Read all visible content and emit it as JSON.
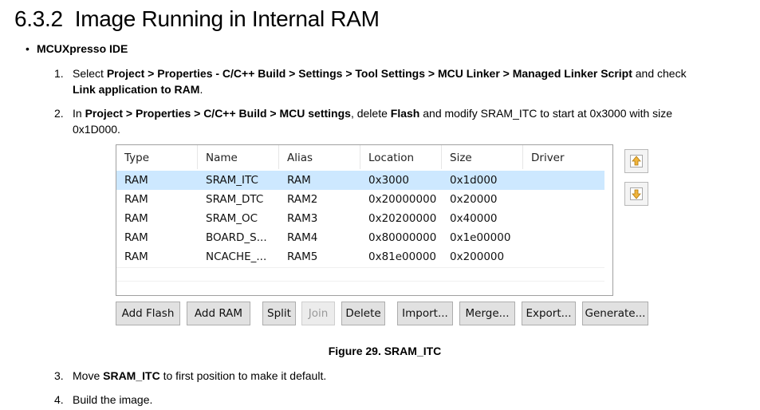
{
  "heading": {
    "number": "6.3.2",
    "title": "Image Running in Internal RAM"
  },
  "bullet": {
    "label": "MCUXpresso IDE"
  },
  "steps": [
    {
      "num": "1.",
      "t1": "Select ",
      "b1": "Project > Properties - C/C++ Build > Settings > Tool Settings > MCU Linker > Managed Linker Script",
      "t2": " and check ",
      "b2": "Link application to RAM",
      "t3": "."
    },
    {
      "num": "2.",
      "t1": "In ",
      "b1": "Project > Properties > C/C++ Build > MCU settings",
      "t2": ", delete ",
      "b2": "Flash",
      "t3": " and modify SRAM_ITC to start at 0x3000 with size 0x1D000."
    },
    {
      "num": "3.",
      "t1": "Move ",
      "b1": "SRAM_ITC",
      "t2": " to first position to make it default."
    },
    {
      "num": "4.",
      "t1": "Build the image."
    }
  ],
  "table": {
    "headers": [
      "Type",
      "Name",
      "Alias",
      "Location",
      "Size",
      "Driver"
    ],
    "rows": [
      [
        "RAM",
        "SRAM_ITC",
        "RAM",
        "0x3000",
        "0x1d000",
        ""
      ],
      [
        "RAM",
        "SRAM_DTC",
        "RAM2",
        "0x20000000",
        "0x20000",
        ""
      ],
      [
        "RAM",
        "SRAM_OC",
        "RAM3",
        "0x20200000",
        "0x40000",
        ""
      ],
      [
        "RAM",
        "BOARD_S...",
        "RAM4",
        "0x80000000",
        "0x1e00000",
        ""
      ],
      [
        "RAM",
        "NCACHE_...",
        "RAM5",
        "0x81e00000",
        "0x200000",
        ""
      ]
    ],
    "selected_row": 0
  },
  "side_buttons": [
    {
      "icon": "move-up-icon"
    },
    {
      "icon": "move-down-icon"
    }
  ],
  "buttons": {
    "add_flash": "Add Flash",
    "add_ram": "Add RAM",
    "split": "Split",
    "join": "Join",
    "delete": "Delete",
    "import": "Import...",
    "merge": "Merge...",
    "export": "Export...",
    "generate": "Generate..."
  },
  "figure": {
    "caption": "Figure 29.  SRAM_ITC"
  },
  "colors": {
    "selection": "#cde8ff",
    "button_face": "#e1e1e1",
    "icon_arrow": "#f0b43c"
  }
}
